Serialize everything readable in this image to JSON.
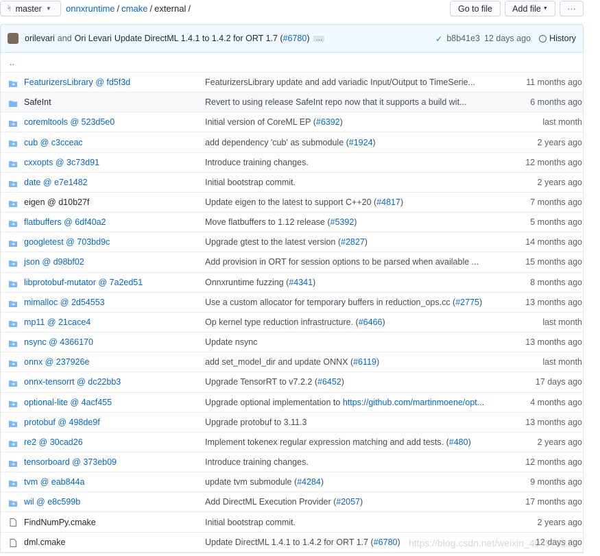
{
  "branch": {
    "label": "master",
    "icon": "git-branch-icon"
  },
  "breadcrumb": {
    "repo": "onnxruntime",
    "dir1": "cmake",
    "current": "external"
  },
  "buttons": {
    "go_to_file": "Go to file",
    "add_file": "Add file",
    "more": "···"
  },
  "commit": {
    "author1": "orilevari",
    "and": "and",
    "author2": "Ori Levari",
    "message": "Update DirectML 1.4.1 to 1.4.2 for ORT 1.7 (",
    "pr": "#6780",
    ")": ")",
    "ellipsis": "…",
    "sha": "b8b41e3",
    "age": "12 days ago",
    "history": "History"
  },
  "parent": "..",
  "colors": {
    "link": "#0366d6",
    "folder": "#79b8ff",
    "header_bg": "#f1f8ff"
  },
  "rows": [
    {
      "name": "FeaturizersLibrary @ fd5f3d",
      "type": "submodule",
      "msg": [
        {
          "t": "FeaturizersLibrary update and add variadic Input/Output to TimeSerie..."
        }
      ],
      "age": "11 months ago"
    },
    {
      "name": "SafeInt",
      "type": "dir",
      "msg": [
        {
          "t": "Revert to using release SafeInt repo now that it supports a build wit..."
        }
      ],
      "age": "6 months ago"
    },
    {
      "name": "coremltools @ 523d5e0",
      "type": "submodule",
      "msg": [
        {
          "t": "Initial version of CoreML EP ("
        },
        {
          "t": "#6392",
          "l": 1
        },
        {
          "t": ")"
        }
      ],
      "age": "last month"
    },
    {
      "name": "cub @ c3cceac",
      "type": "submodule",
      "msg": [
        {
          "t": "add dependency 'cub' as submodule ("
        },
        {
          "t": "#1924",
          "l": 1
        },
        {
          "t": ")"
        }
      ],
      "age": "2 years ago"
    },
    {
      "name": "cxxopts @ 3c73d91",
      "type": "submodule",
      "msg": [
        {
          "t": "Introduce training changes."
        }
      ],
      "age": "12 months ago"
    },
    {
      "name": "date @ e7e1482",
      "type": "submodule",
      "msg": [
        {
          "t": "Initial bootstrap commit."
        }
      ],
      "age": "2 years ago"
    },
    {
      "name": "eigen @ d10b27f",
      "type": "submodule-plain",
      "msg": [
        {
          "t": "Update eigen to the latest to support C++20 ("
        },
        {
          "t": "#4817",
          "l": 1
        },
        {
          "t": ")"
        }
      ],
      "age": "7 months ago"
    },
    {
      "name": "flatbuffers @ 6df40a2",
      "type": "submodule",
      "msg": [
        {
          "t": "Move flatbuffers to 1.12 release ("
        },
        {
          "t": "#5392",
          "l": 1
        },
        {
          "t": ")"
        }
      ],
      "age": "5 months ago"
    },
    {
      "name": "googletest @ 703bd9c",
      "type": "submodule",
      "msg": [
        {
          "t": "Upgrade gtest to the latest version ("
        },
        {
          "t": "#2827",
          "l": 1
        },
        {
          "t": ")"
        }
      ],
      "age": "14 months ago"
    },
    {
      "name": "json @ d98bf02",
      "type": "submodule",
      "msg": [
        {
          "t": "Add provision in ORT for session options to be parsed when available ..."
        }
      ],
      "age": "15 months ago"
    },
    {
      "name": "libprotobuf-mutator @ 7a2ed51",
      "type": "submodule",
      "msg": [
        {
          "t": "Onnxruntime fuzzing ("
        },
        {
          "t": "#4341",
          "l": 1
        },
        {
          "t": ")"
        }
      ],
      "age": "8 months ago"
    },
    {
      "name": "mimalloc @ 2d54553",
      "type": "submodule",
      "msg": [
        {
          "t": "Use a custom allocator for temporary buffers in reduction_ops.cc ("
        },
        {
          "t": "#2775",
          "l": 1
        },
        {
          "t": ")"
        }
      ],
      "age": "13 months ago"
    },
    {
      "name": "mp11 @ 21cace4",
      "type": "submodule",
      "msg": [
        {
          "t": "Op kernel type reduction infrastructure. ("
        },
        {
          "t": "#6466",
          "l": 1
        },
        {
          "t": ")"
        }
      ],
      "age": "last month"
    },
    {
      "name": "nsync @ 4366170",
      "type": "submodule",
      "msg": [
        {
          "t": "Update nsync"
        }
      ],
      "age": "13 months ago"
    },
    {
      "name": "onnx @ 237926e",
      "type": "submodule",
      "msg": [
        {
          "t": "add set_model_dir and update ONNX ("
        },
        {
          "t": "#6119",
          "l": 1
        },
        {
          "t": ")"
        }
      ],
      "age": "last month"
    },
    {
      "name": "onnx-tensorrt @ dc22bb3",
      "type": "submodule",
      "msg": [
        {
          "t": "Upgrade TensorRT to v7.2.2 ("
        },
        {
          "t": "#6452",
          "l": 1
        },
        {
          "t": ")"
        }
      ],
      "age": "17 days ago"
    },
    {
      "name": "optional-lite @ 4acf455",
      "type": "submodule",
      "msg": [
        {
          "t": "Upgrade optional implementation to "
        },
        {
          "t": "https://github.com/martinmoene/opt...",
          "l": 1
        }
      ],
      "age": "4 months ago"
    },
    {
      "name": "protobuf @ 498de9f",
      "type": "submodule",
      "msg": [
        {
          "t": "Upgrade protobuf to 3.11.3"
        }
      ],
      "age": "13 months ago"
    },
    {
      "name": "re2 @ 30cad26",
      "type": "submodule",
      "msg": [
        {
          "t": "Implement tokenex regular expression matching and add tests. ("
        },
        {
          "t": "#480",
          "l": 1
        },
        {
          "t": ")"
        }
      ],
      "age": "2 years ago"
    },
    {
      "name": "tensorboard @ 373eb09",
      "type": "submodule",
      "msg": [
        {
          "t": "Introduce training changes."
        }
      ],
      "age": "12 months ago"
    },
    {
      "name": "tvm @ eab844a",
      "type": "submodule",
      "msg": [
        {
          "t": "update tvm submodule ("
        },
        {
          "t": "#4284",
          "l": 1
        },
        {
          "t": ")"
        }
      ],
      "age": "9 months ago"
    },
    {
      "name": "wil @ e8c599b",
      "type": "submodule",
      "msg": [
        {
          "t": "Add DirectML Execution Provider ("
        },
        {
          "t": "#2057",
          "l": 1
        },
        {
          "t": ")"
        }
      ],
      "age": "17 months ago"
    },
    {
      "name": "FindNumPy.cmake",
      "type": "file",
      "msg": [
        {
          "t": "Initial bootstrap commit."
        }
      ],
      "age": "2 years ago"
    },
    {
      "name": "dml.cmake",
      "type": "file",
      "msg": [
        {
          "t": "Update DirectML 1.4.1 to 1.4.2 for ORT 1.7 ("
        },
        {
          "t": "#6780",
          "l": 1
        },
        {
          "t": ")"
        }
      ],
      "age": "12 days ago"
    }
  ],
  "watermark": "https://blog.csdn.net/weixin_40497821"
}
